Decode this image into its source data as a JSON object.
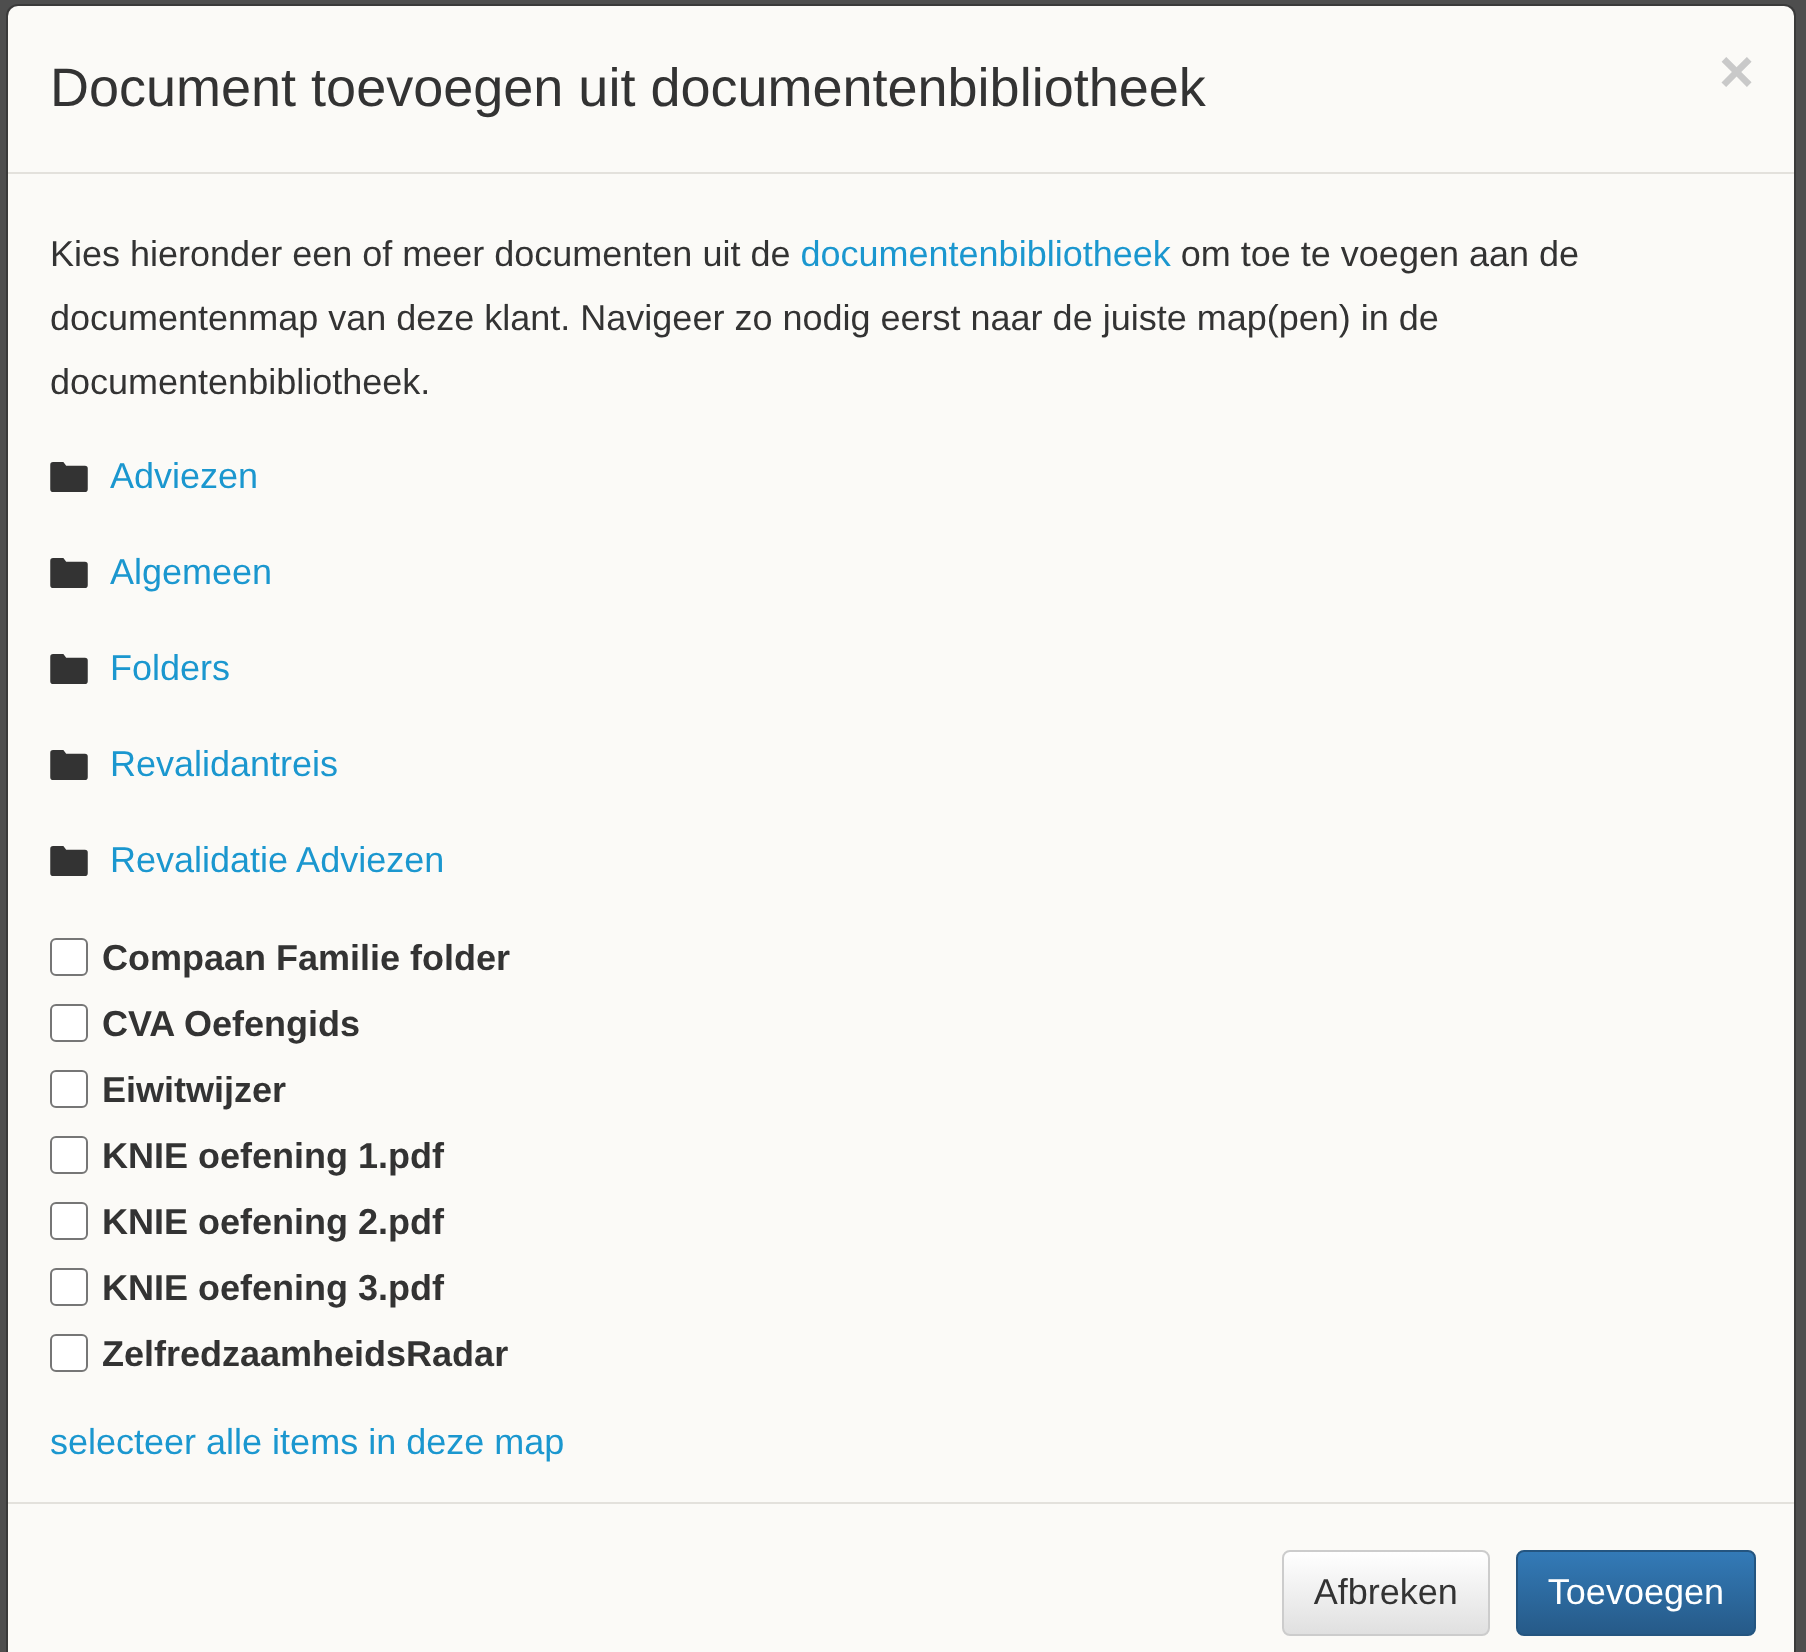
{
  "dialog": {
    "title": "Document toevoegen uit documentenbibliotheek",
    "close": "×"
  },
  "intro": {
    "before": "Kies hieronder een of meer documenten uit de ",
    "link": "documentenbibliotheek",
    "after": " om toe te voegen aan de documentenmap van deze klant. Navigeer zo nodig eerst naar de juiste map(pen) in de documentenbibliotheek."
  },
  "folders": [
    {
      "name": "Adviezen"
    },
    {
      "name": "Algemeen"
    },
    {
      "name": "Folders"
    },
    {
      "name": "Revalidantreis"
    },
    {
      "name": "Revalidatie Adviezen"
    }
  ],
  "documents": [
    {
      "name": "Compaan Familie folder",
      "checked": false
    },
    {
      "name": "CVA Oefengids",
      "checked": false
    },
    {
      "name": "Eiwitwijzer",
      "checked": false
    },
    {
      "name": "KNIE oefening 1.pdf",
      "checked": false
    },
    {
      "name": "KNIE oefening 2.pdf",
      "checked": false
    },
    {
      "name": "KNIE oefening 3.pdf",
      "checked": false
    },
    {
      "name": "ZelfredzaamheidsRadar",
      "checked": false
    }
  ],
  "select_all": "selecteer alle items in deze map",
  "buttons": [
    {
      "label": "Afbreken",
      "kind": "default"
    },
    {
      "label": "Toevoegen",
      "kind": "primary"
    }
  ]
}
